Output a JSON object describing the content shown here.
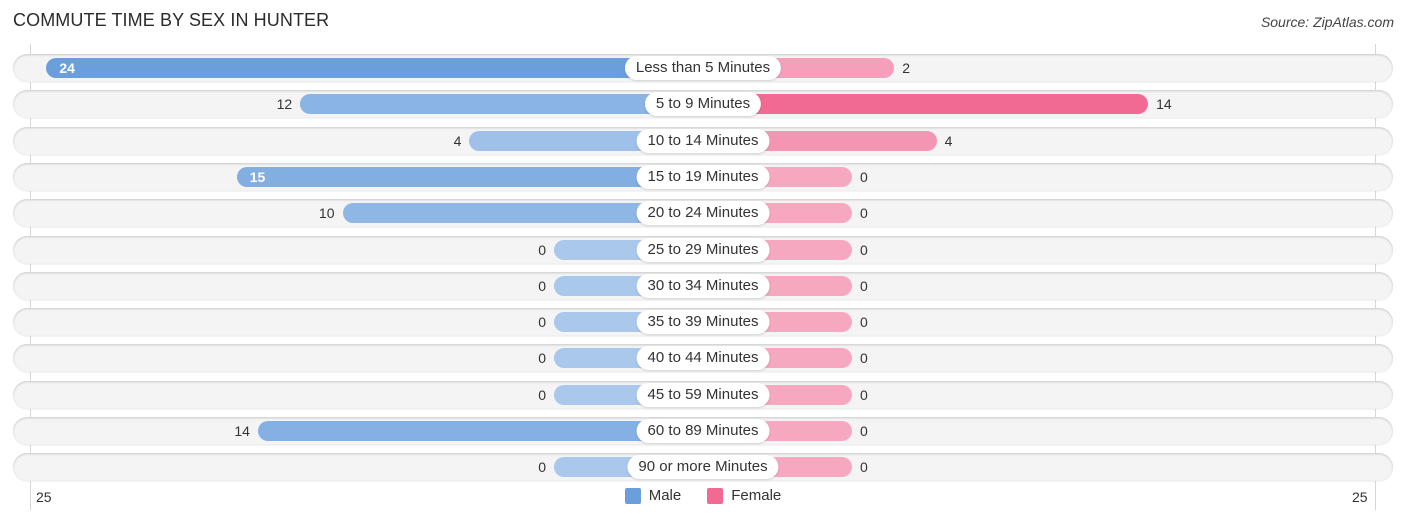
{
  "header": {
    "title": "COMMUTE TIME BY SEX IN HUNTER",
    "source": "Source: ZipAtlas.com"
  },
  "colors": {
    "male": "#6a9fdc",
    "male_light": "#a9c8ec",
    "female": "#f06a94",
    "female_light": "#f6a8c0"
  },
  "axis": {
    "left_label": "25",
    "right_label": "25"
  },
  "legend": [
    {
      "label": "Male",
      "color": "#6a9fdc"
    },
    {
      "label": "Female",
      "color": "#f06a94"
    }
  ],
  "chart_data": {
    "type": "bar",
    "orientation": "horizontal-diverging",
    "title": "COMMUTE TIME BY SEX IN HUNTER",
    "categories": [
      "Less than 5 Minutes",
      "5 to 9 Minutes",
      "10 to 14 Minutes",
      "15 to 19 Minutes",
      "20 to 24 Minutes",
      "25 to 29 Minutes",
      "30 to 34 Minutes",
      "35 to 39 Minutes",
      "40 to 44 Minutes",
      "45 to 59 Minutes",
      "60 to 89 Minutes",
      "90 or more Minutes"
    ],
    "series": [
      {
        "name": "Male",
        "values": [
          24,
          12,
          4,
          15,
          10,
          0,
          0,
          0,
          0,
          0,
          14,
          0
        ]
      },
      {
        "name": "Female",
        "values": [
          2,
          14,
          4,
          0,
          0,
          0,
          0,
          0,
          0,
          0,
          0,
          0
        ]
      }
    ],
    "xlim": [
      -25,
      25
    ],
    "xlabel": "",
    "ylabel": "",
    "legend_position": "bottom-center",
    "grid": false
  }
}
